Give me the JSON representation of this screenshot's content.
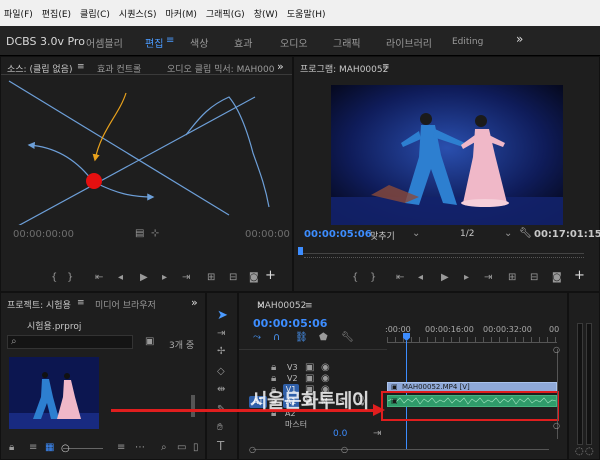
{
  "menu": [
    "파일(F)",
    "편집(E)",
    "클립(C)",
    "시퀀스(S)",
    "마커(M)",
    "그래픽(G)",
    "창(W)",
    "도움말(H)"
  ],
  "workspace": {
    "app_title": "DCBS 3.0v Pro",
    "tabs": [
      "어셈블리",
      "편집",
      "색상",
      "효과",
      "오디오",
      "그래픽",
      "라이브러리",
      "Editing"
    ],
    "active_tab": "편집",
    "more": "»"
  },
  "source_panel": {
    "tabs": [
      "소스: (클립 없음)",
      "효과 컨트롤",
      "오디오 클립 믹서: MAH000"
    ],
    "timecode_left": "00:00:00:00",
    "timecode_right": "00:00:00",
    "more": "»"
  },
  "program_panel": {
    "title": "프로그램: MAH00052",
    "timecode": "00:00:05:06",
    "fit": "맞추기",
    "resolution": "1/2",
    "duration": "00:17:01:15"
  },
  "project_panel": {
    "tabs": [
      "프로젝트: 시험용",
      "미디어 브라우저"
    ],
    "file": "시험용.prproj",
    "items_count": "3개 중",
    "more": "»"
  },
  "timeline": {
    "title": "MAH00052",
    "timecode": "00:00:05:06",
    "ruler": [
      ":00:00",
      "00:00:16:00",
      "00:00:32:00",
      "00"
    ],
    "video_tracks": [
      "V3",
      "V2",
      "V1"
    ],
    "audio_tracks": [
      "A1",
      "A2"
    ],
    "source_patch": "A1",
    "clip_label": "MAH00052.MP4 [V]",
    "master_value": "0.0",
    "master_label": "마스터",
    "colors": {
      "accent": "#3d8dff",
      "video_clip": "#8fa9d8",
      "audio_clip": "#2f9b6a",
      "arrow": "#e01e1e"
    }
  },
  "tools": [
    "selection",
    "track-select",
    "ripple",
    "razor",
    "slip",
    "pen",
    "hand",
    "type"
  ],
  "watermark": "서울문화투데이"
}
